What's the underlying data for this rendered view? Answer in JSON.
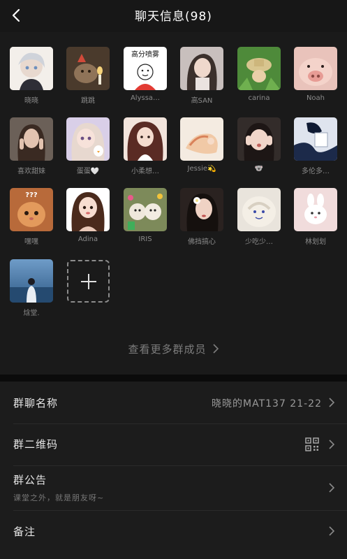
{
  "header": {
    "title": "聊天信息(98)"
  },
  "members": [
    {
      "name": "晓晓",
      "bg": "#f3efea"
    },
    {
      "name": "跳跳",
      "bg": "#4a3a2c"
    },
    {
      "name": "Alyssa…",
      "bg": "#ffffff",
      "caption": "高分喷雾"
    },
    {
      "name": "高SAN",
      "bg": "#c8bfbd"
    },
    {
      "name": "carina",
      "bg": "#4e8a3a"
    },
    {
      "name": "Noah",
      "bg": "#e9c3bb"
    },
    {
      "name": "喜欢甜妹",
      "bg": "#6b6058"
    },
    {
      "name": "蛋蛋🤍",
      "bg": "#d9cfe8"
    },
    {
      "name": "小柔想…",
      "bg": "#f2e4dc"
    },
    {
      "name": "Jessie💫",
      "bg": "#f4ebe1"
    },
    {
      "name": "🐨",
      "bg": "#332c2a"
    },
    {
      "name": "多伦多…",
      "bg": "#dfe4ee"
    },
    {
      "name": "嘿嘿",
      "bg": "#b86a3a",
      "caption": "???"
    },
    {
      "name": "Adina",
      "bg": "#f3dfd4"
    },
    {
      "name": "IRIS",
      "bg": "#7d8a5a"
    },
    {
      "name": "佛挡搞心",
      "bg": "#2a2220"
    },
    {
      "name": "少吃少…",
      "bg": "#e9e4dc"
    },
    {
      "name": "林划划",
      "bg": "#f1dcdc"
    },
    {
      "name": "焓堂.",
      "bg": "#4d7ea8"
    }
  ],
  "add_member": {
    "icon": "plus-icon"
  },
  "more_members": {
    "label": "查看更多群成员"
  },
  "settings": {
    "group_name": {
      "label": "群聊名称",
      "value": "晓晓的MAT137 21-22"
    },
    "group_qr": {
      "label": "群二维码",
      "icon": "qr-code-icon"
    },
    "announcement": {
      "label": "群公告",
      "preview": "课堂之外，就是朋友呀~"
    },
    "remark": {
      "label": "备注"
    }
  },
  "colors": {
    "background": "#111111",
    "panel": "#1c1c1c",
    "secondary_text": "#9a9a9a"
  }
}
